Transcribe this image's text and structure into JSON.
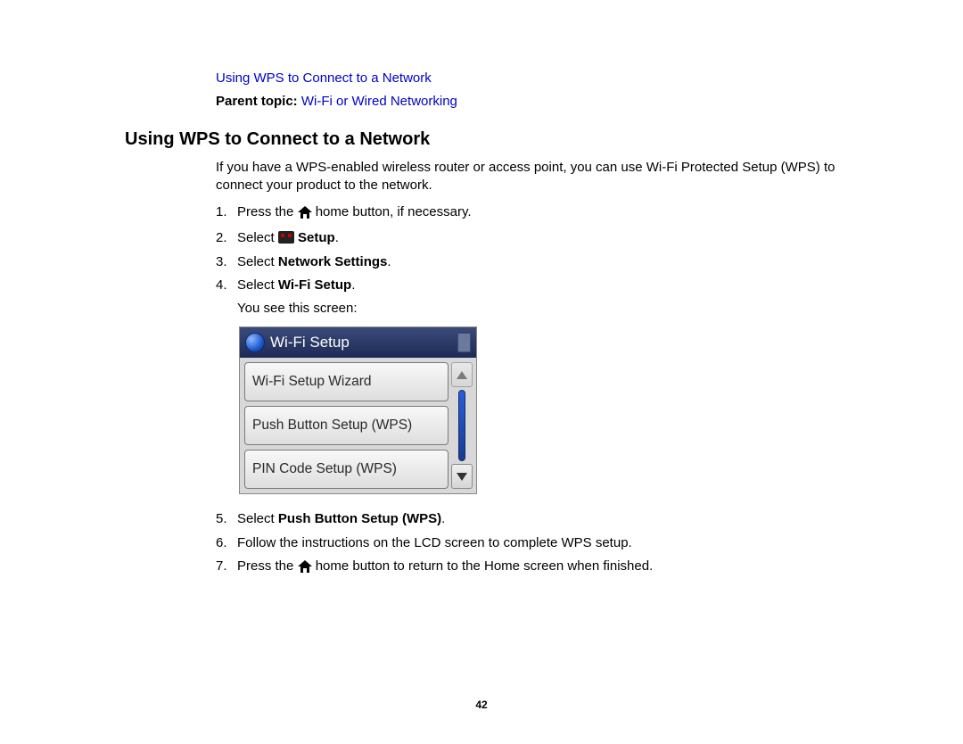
{
  "top_link": "Using WPS to Connect to a Network",
  "parent_topic": {
    "label": "Parent topic:",
    "link": "Wi-Fi or Wired Networking"
  },
  "section_title": "Using WPS to Connect to a Network",
  "intro": "If you have a WPS-enabled wireless router or access point, you can use Wi-Fi Protected Setup (WPS) to connect your product to the network.",
  "steps": {
    "s1": {
      "num": "1.",
      "pre": "Press the ",
      "post": " home button, if necessary."
    },
    "s2": {
      "num": "2.",
      "pre": "Select ",
      "bold": "Setup",
      "post": "."
    },
    "s3": {
      "num": "3.",
      "pre": "Select ",
      "bold": "Network Settings",
      "post": "."
    },
    "s4": {
      "num": "4.",
      "pre": "Select ",
      "bold": "Wi-Fi Setup",
      "post": ".",
      "sub": "You see this screen:"
    },
    "s5": {
      "num": "5.",
      "pre": "Select ",
      "bold": "Push Button Setup (WPS)",
      "post": "."
    },
    "s6": {
      "num": "6.",
      "text": "Follow the instructions on the LCD screen to complete WPS setup."
    },
    "s7": {
      "num": "7.",
      "pre": "Press the ",
      "post": " home button to return to the Home screen when finished."
    }
  },
  "lcd": {
    "title": "Wi-Fi Setup",
    "options": [
      "Wi-Fi Setup Wizard",
      "Push Button Setup (WPS)",
      "PIN Code Setup (WPS)"
    ]
  },
  "page_number": "42"
}
